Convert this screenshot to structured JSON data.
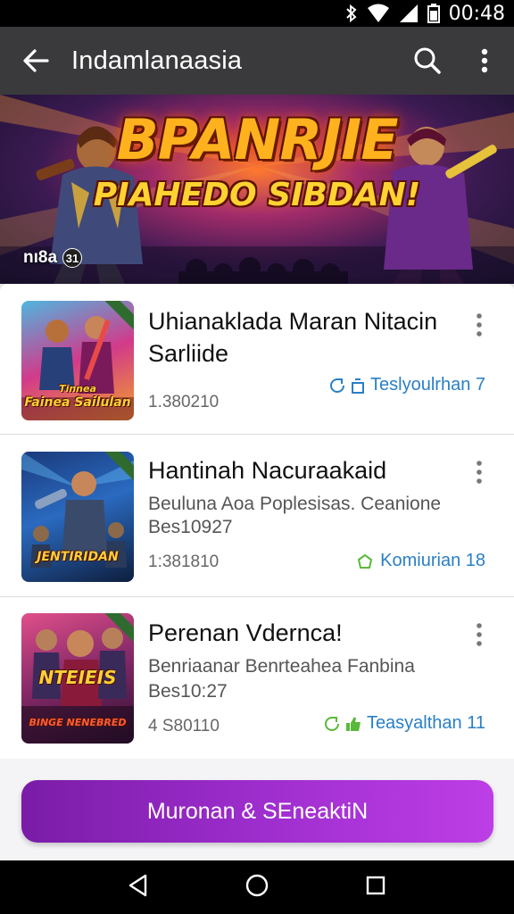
{
  "status_bar": {
    "time": "00:48"
  },
  "app_bar": {
    "title": "Indamlanaasia"
  },
  "hero": {
    "headline_line1": "BPANRJIE",
    "headline_line2": "PIAHEDO SIBDAN!",
    "caption": "nı8a",
    "caption_count": "31"
  },
  "items": [
    {
      "title_line1": "Uhianaklada Maran Nitacin",
      "title_line2": "Sarliide",
      "subtitle_line1": "",
      "subtitle_line2": "",
      "meta": "1.380210",
      "stat": "Teslyoulrhan 7",
      "thumb_label_1": "Tinnea",
      "thumb_label_2": "Fainea Sailulan"
    },
    {
      "title_line1": "Hantinah Nacuraakaid",
      "title_line2": "",
      "subtitle_line1": "Beuluna Aoa Poplesisas. Ceanione",
      "subtitle_line2": "Bes10927",
      "meta": "1:381810",
      "stat": "Komiurian 18",
      "thumb_label_1": "JENTIRIDAN",
      "thumb_label_2": ""
    },
    {
      "title_line1": "Perenan Vdernca!",
      "title_line2": "",
      "subtitle_line1": "Benriaanar Benrteahea Fanbina",
      "subtitle_line2": "Bes10:27",
      "meta": "4 S80110",
      "stat": "Teasyalthan 11",
      "thumb_label_1": "NTEIEIS",
      "thumb_label_2": "BINGE NENEBRED"
    }
  ],
  "cta": {
    "label": "Muronan & SEneaktiN"
  },
  "colors": {
    "accent_purple": "#a12fd0",
    "link_blue": "#2a7fc4",
    "app_bar": "#3a3a3c"
  }
}
